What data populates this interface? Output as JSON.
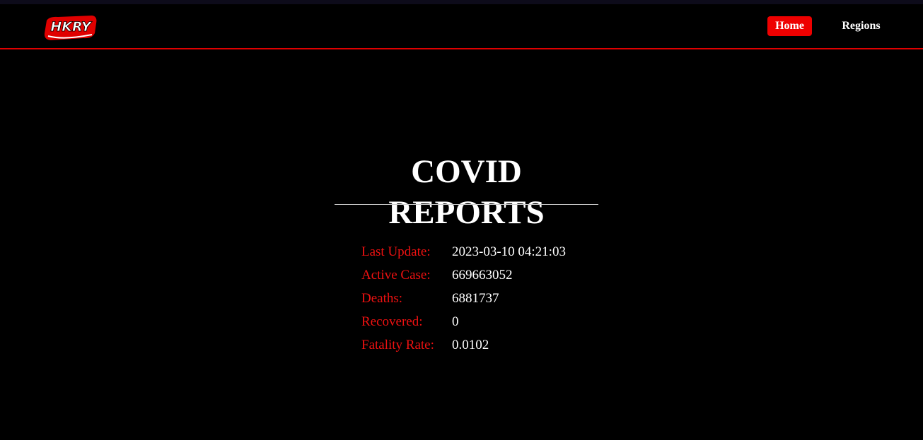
{
  "nav": {
    "logo_text": "HKRY",
    "links": [
      {
        "label": "Home",
        "active": true
      },
      {
        "label": "Regions",
        "active": false
      }
    ]
  },
  "colors": {
    "accent": "#ee0000",
    "background": "#000000",
    "text": "#ffffff"
  },
  "main": {
    "title": "COVID REPORTS",
    "stats": [
      {
        "label": "Last Update:",
        "value": "2023-03-10 04:21:03"
      },
      {
        "label": "Active Case:",
        "value": "669663052"
      },
      {
        "label": "Deaths:",
        "value": "6881737"
      },
      {
        "label": "Recovered:",
        "value": "0"
      },
      {
        "label": "Fatality Rate:",
        "value": "0.0102"
      }
    ]
  }
}
